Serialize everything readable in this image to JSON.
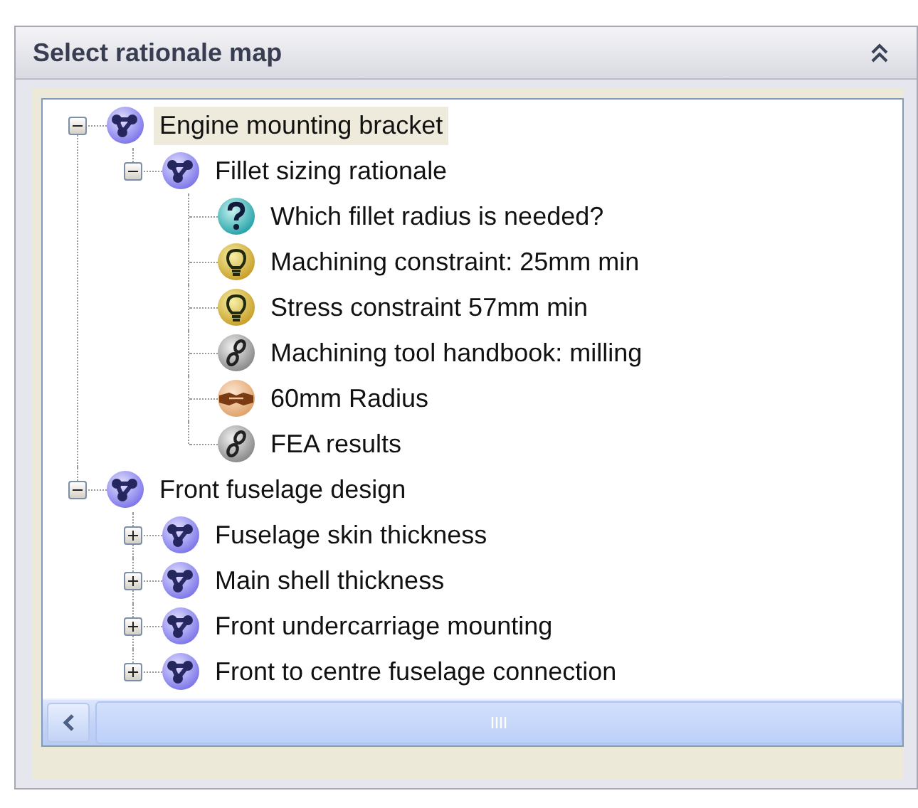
{
  "panel": {
    "title": "Select rationale map"
  },
  "tree": [
    {
      "label": "Engine mounting bracket",
      "kind": "map",
      "expanded": true,
      "selected": true,
      "children": [
        {
          "label": "Fillet sizing rationale",
          "kind": "map",
          "expanded": true,
          "selected": false,
          "children": [
            {
              "label": "Which fillet radius is needed?",
              "kind": "question",
              "selected": false
            },
            {
              "label": "Machining constraint: 25mm min",
              "kind": "idea",
              "selected": false
            },
            {
              "label": "Stress constraint 57mm min",
              "kind": "idea",
              "selected": false
            },
            {
              "label": "Machining tool handbook: milling",
              "kind": "reference",
              "selected": false
            },
            {
              "label": "60mm Radius",
              "kind": "decision",
              "selected": false
            },
            {
              "label": "FEA results",
              "kind": "reference",
              "selected": false
            }
          ]
        }
      ]
    },
    {
      "label": "Front fuselage design",
      "kind": "map",
      "expanded": true,
      "selected": false,
      "children": [
        {
          "label": "Fuselage skin thickness",
          "kind": "map",
          "expanded": false,
          "selected": false
        },
        {
          "label": "Main shell thickness",
          "kind": "map",
          "expanded": false,
          "selected": false
        },
        {
          "label": "Front undercarriage mounting",
          "kind": "map",
          "expanded": false,
          "selected": false
        },
        {
          "label": "Front to centre fuselage connection",
          "kind": "map",
          "expanded": false,
          "selected": false
        }
      ]
    }
  ]
}
